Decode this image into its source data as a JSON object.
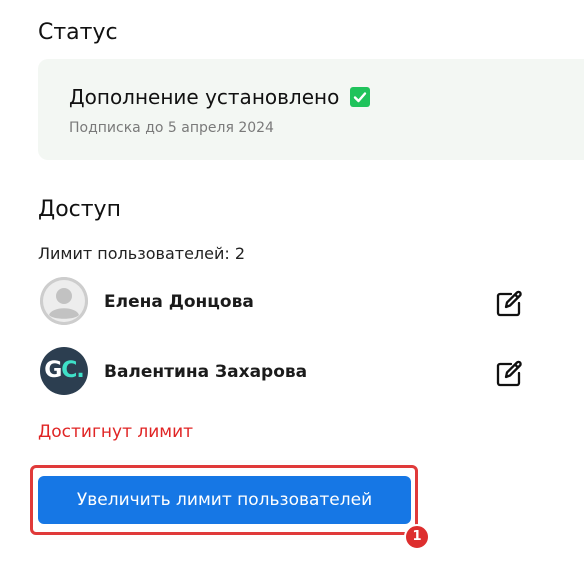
{
  "status": {
    "title": "Статус",
    "card": {
      "heading": "Дополнение установлено",
      "subscription": "Подписка до 5 апреля 2024"
    }
  },
  "access": {
    "title": "Доступ",
    "limit_label": "Лимит пользователей: 2",
    "users": [
      {
        "name": "Елена Донцова",
        "avatar": "default-avatar-icon"
      },
      {
        "name": "Валентина Захарова",
        "avatar_initials": "G",
        "avatar_initials_accent": "C."
      }
    ],
    "limit_reached": "Достигнут лимит",
    "increase_button": "Увеличить лимит пользователей"
  },
  "annotation": {
    "step_badge": "1"
  },
  "colors": {
    "primary": "#1677e5",
    "success": "#1fc35b",
    "error": "#e02424",
    "highlight": "#e03a3a",
    "card_bg": "#f3f7f3",
    "avatar_dark": "#2c3e50",
    "avatar_accent": "#3fe0c8"
  }
}
